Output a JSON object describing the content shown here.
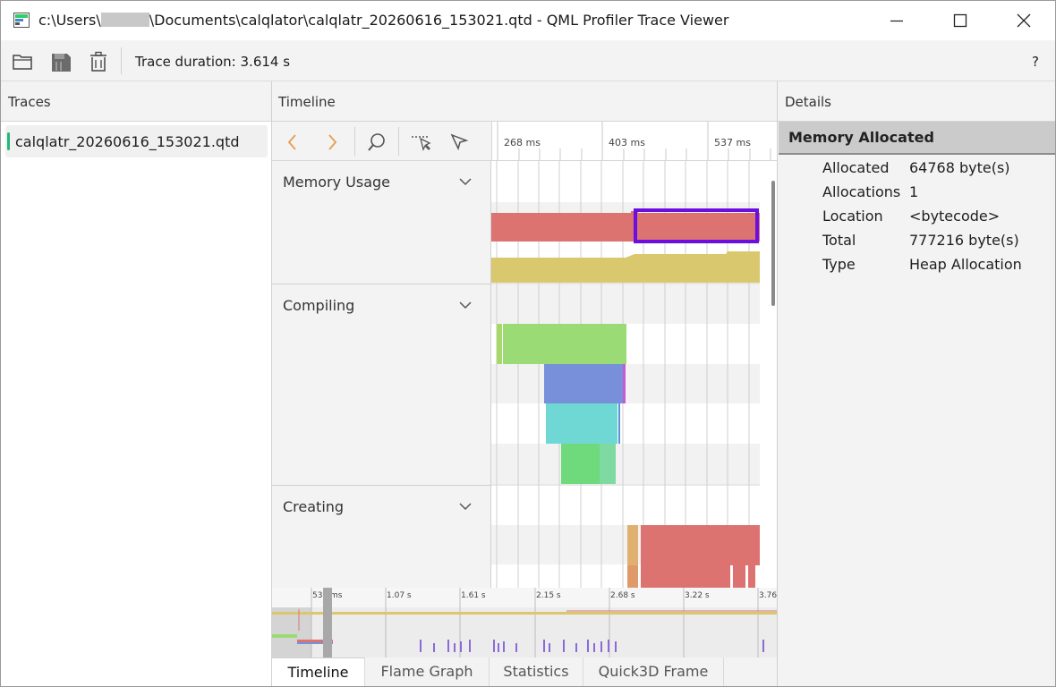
{
  "window": {
    "title_prefix": "c:\\Users\\",
    "title_suffix": "\\Documents\\calqlator\\calqlatr_20260616_153021.qtd - QML Profiler Trace Viewer"
  },
  "toolbar": {
    "open_icon": "folder-open-icon",
    "save_icon": "save-trace-icon",
    "clear_icon": "trash-icon",
    "trace_duration": "Trace duration: 3.614 s",
    "help_label": "?"
  },
  "traces": {
    "header": "Traces",
    "items": [
      {
        "name": "calqlatr_20260616_153021.qtd"
      }
    ]
  },
  "timeline": {
    "header": "Timeline",
    "ruler_ticks": [
      "268 ms",
      "403 ms",
      "537 ms"
    ],
    "categories": [
      {
        "label": "Memory Usage"
      },
      {
        "label": "Compiling"
      },
      {
        "label": "Creating"
      }
    ],
    "overview_ticks": [
      "537 ms",
      "1.07 s",
      "1.61 s",
      "2.15 s",
      "2.68 s",
      "3.22 s",
      "3.76"
    ],
    "tabs": [
      "Timeline",
      "Flame Graph",
      "Statistics",
      "Quick3D Frame"
    ],
    "active_tab": 0
  },
  "details": {
    "header": "Details",
    "title": "Memory Allocated",
    "rows": [
      {
        "key": "Allocated",
        "value": "64768 byte(s)"
      },
      {
        "key": "Allocations",
        "value": "1"
      },
      {
        "key": "Location",
        "value": "<bytecode>"
      },
      {
        "key": "Total",
        "value": "777216 byte(s)"
      },
      {
        "key": "Type",
        "value": "Heap Allocation"
      }
    ]
  },
  "colors": {
    "memory_red": "#dc7371",
    "memory_yellow": "#d9c86d",
    "selection": "#6a0fe0",
    "compile_green": "#9bdb75",
    "compile_blue": "#7790d9",
    "compile_cyan": "#6fd8d4",
    "compile_green2": "#6fda7c",
    "arrow_orange": "#e7a25a"
  }
}
